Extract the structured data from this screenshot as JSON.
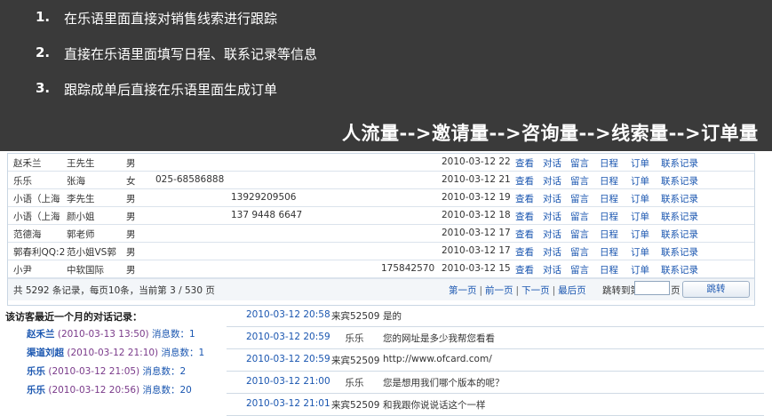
{
  "banner": {
    "items": [
      {
        "num": "1.",
        "text": "在乐语里面直接对销售线索进行跟踪"
      },
      {
        "num": "2.",
        "text": "直接在乐语里面填写日程、联系记录等信息"
      },
      {
        "num": "3.",
        "text": "跟踪成单后直接在乐语里面生成订单"
      }
    ],
    "flow": "人流量-->邀请量-->咨询量-->线索量-->订单量"
  },
  "actions": [
    "查看",
    "对话",
    "留言",
    "日程",
    "订单",
    "联系记录"
  ],
  "grid_rows": [
    {
      "name": "赵禾兰",
      "contact": "王先生",
      "sex": "男",
      "tel1": "",
      "tel2": "",
      "tel3": "",
      "time": "2010-03-12 22:1"
    },
    {
      "name": "乐乐",
      "contact": "张海",
      "sex": "女",
      "tel1": "025-68586888",
      "tel2": "",
      "tel3": "",
      "time": "2010-03-12 21:0"
    },
    {
      "name": "小语（上海",
      "contact": "李先生",
      "sex": "男",
      "tel1": "",
      "tel2": "13929209506",
      "tel3": "",
      "time": "2010-03-12 19:1"
    },
    {
      "name": "小语（上海",
      "contact": "颜小姐",
      "sex": "男",
      "tel1": "",
      "tel2": "137 9448 6647",
      "tel3": "",
      "time": "2010-03-12 18:4"
    },
    {
      "name": "范德海",
      "contact": "郭老师",
      "sex": "男",
      "tel1": "",
      "tel2": "",
      "tel3": "",
      "time": "2010-03-12 17:1"
    },
    {
      "name": "郭春利QQ:2",
      "contact": "范小姐VS郭",
      "sex": "男",
      "tel1": "",
      "tel2": "",
      "tel3": "",
      "time": "2010-03-12 17:0"
    },
    {
      "name": "小尹",
      "contact": "中软国际",
      "sex": "男",
      "tel1": "",
      "tel2": "",
      "tel3": "175842570",
      "time": "2010-03-12 15:4"
    }
  ],
  "footer": {
    "summary": "共 5292 条记录，每页10条，当前第 3 / 530 页",
    "first": "第一页",
    "prev": "前一页",
    "next": "下一页",
    "last": "最后页",
    "sep": "|",
    "jump_label": "跳转到第",
    "jump_value": "",
    "jump_unit": "页",
    "jump_button": "跳转"
  },
  "recent": {
    "title": "该访客最近一个月的对话记录：",
    "items": [
      {
        "name": "赵禾兰",
        "time": "(2010-03-13 13:50)",
        "count": "消息数：1"
      },
      {
        "name": "渠道刘超",
        "time": "(2010-03-12 21:10)",
        "count": "消息数：1"
      },
      {
        "name": "乐乐",
        "time": "(2010-03-12 21:05)",
        "count": "消息数：2"
      },
      {
        "name": "乐乐",
        "time": "(2010-03-12 20:56)",
        "count": "消息数：20"
      }
    ]
  },
  "log": [
    {
      "time": "2010-03-12 20:58",
      "who": "来宾52509",
      "msg": "是的"
    },
    {
      "time": "2010-03-12 20:59",
      "who": "乐乐",
      "msg": "您的网址是多少我帮您看看"
    },
    {
      "time": "2010-03-12 20:59",
      "who": "来宾52509",
      "msg": "http://www.ofcard.com/"
    },
    {
      "time": "2010-03-12 21:00",
      "who": "乐乐",
      "msg": "您是想用我们哪个版本的呢？"
    },
    {
      "time": "2010-03-12 21:01",
      "who": "来宾52509",
      "msg": "和我跟你说说话这个一样"
    }
  ]
}
